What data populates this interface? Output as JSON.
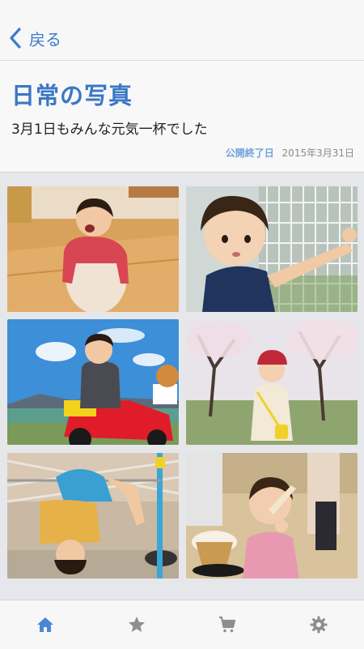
{
  "nav": {
    "back_label": "戻る"
  },
  "album": {
    "title": "日常の写真",
    "description": "3月1日もみんな元気一杯でした",
    "expiry_label": "公開終了日",
    "expiry_date": "2015年3月31日"
  },
  "colors": {
    "accent": "#3a78c4",
    "tab_active": "#4a86d6",
    "tab_inactive": "#8d8d92"
  },
  "tabs": [
    {
      "icon": "home-icon",
      "active": true
    },
    {
      "icon": "star-icon",
      "active": false
    },
    {
      "icon": "cart-icon",
      "active": false
    },
    {
      "icon": "gear-icon",
      "active": false
    }
  ]
}
